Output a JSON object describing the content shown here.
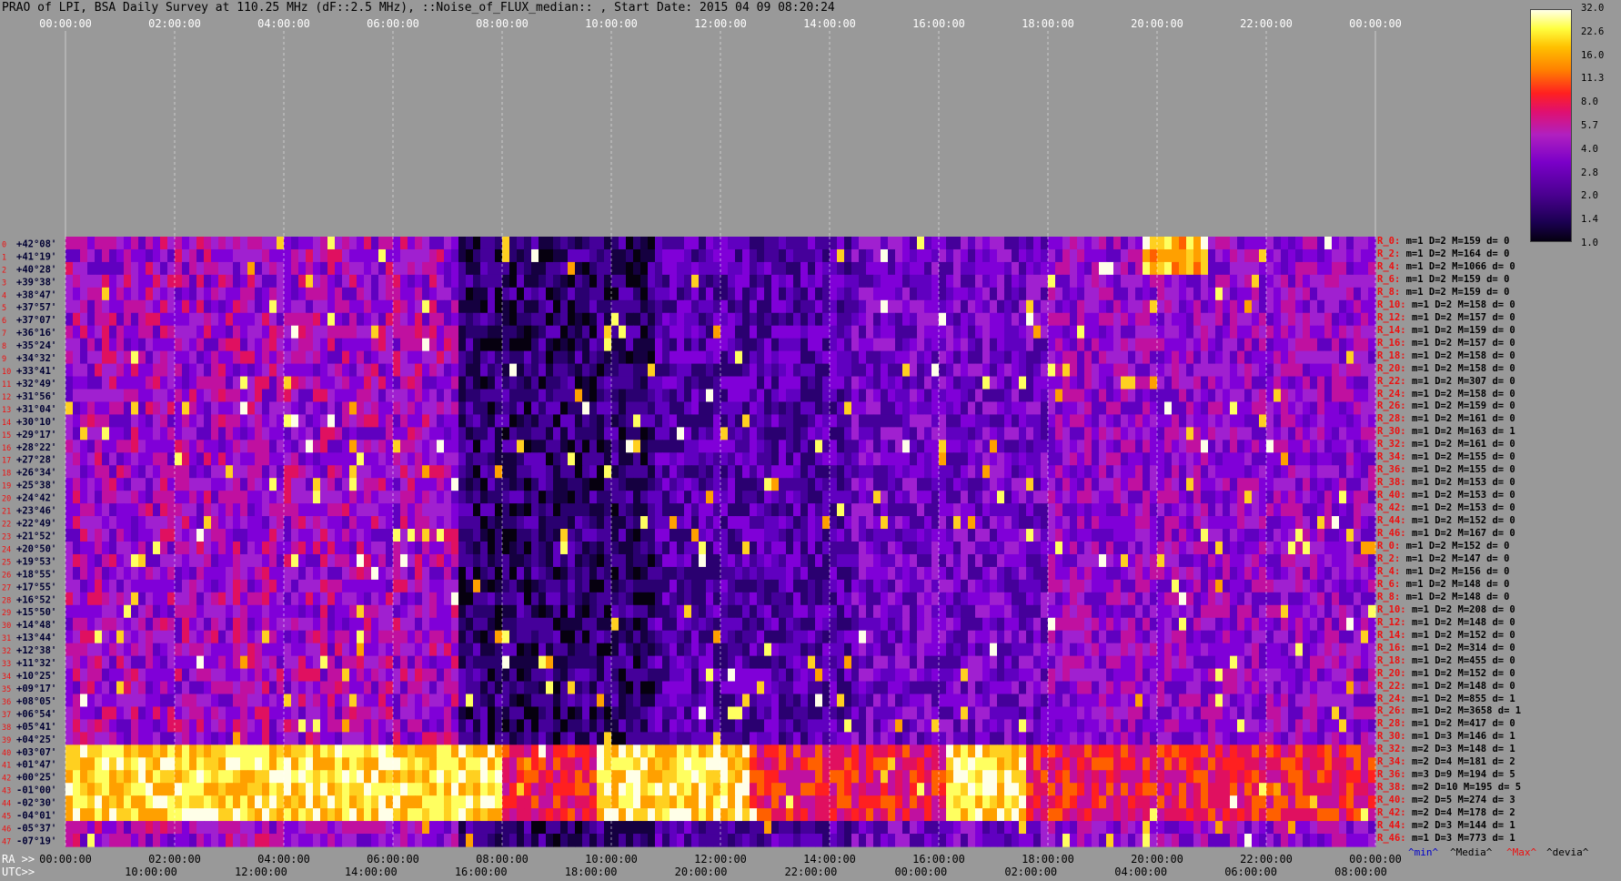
{
  "title": "PRAO of LPI, BSA Daily Survey at 110.25 MHz (dF::2.5 MHz), ::Noise_of_FLUX_median:: , Start Date: 2015 04 09 08:20:24",
  "chart_data": {
    "type": "heatmap",
    "top_axis_labels": [
      "00:00:00",
      "02:00:00",
      "04:00:00",
      "06:00:00",
      "08:00:00",
      "10:00:00",
      "12:00:00",
      "14:00:00",
      "16:00:00",
      "18:00:00",
      "20:00:00",
      "22:00:00",
      "00:00:00"
    ],
    "bottom_axis_prefix_ra": "RA >>",
    "bottom_axis_prefix_utc": "UTC>>",
    "ra_labels": [
      "00:00:00",
      "02:00:00",
      "04:00:00",
      "06:00:00",
      "08:00:00",
      "10:00:00",
      "12:00:00",
      "14:00:00",
      "16:00:00",
      "18:00:00",
      "20:00:00",
      "22:00:00",
      "00:00:00"
    ],
    "utc_labels": [
      "10:00:00",
      "12:00:00",
      "14:00:00",
      "16:00:00",
      "18:00:00",
      "20:00:00",
      "22:00:00",
      "00:00:00",
      "02:00:00",
      "04:00:00",
      "06:00:00",
      "08:00:00"
    ],
    "declinations": [
      "+42°08'",
      "+41°19'",
      "+40°28'",
      "+39°38'",
      "+38°47'",
      "+37°57'",
      "+37°07'",
      "+36°16'",
      "+35°24'",
      "+34°32'",
      "+33°41'",
      "+32°49'",
      "+31°56'",
      "+31°04'",
      "+30°10'",
      "+29°17'",
      "+28°22'",
      "+27°28'",
      "+26°34'",
      "+25°38'",
      "+24°42'",
      "+23°46'",
      "+22°49'",
      "+21°52'",
      "+20°50'",
      "+19°53'",
      "+18°55'",
      "+17°55'",
      "+16°52'",
      "+15°50'",
      "+14°48'",
      "+13°44'",
      "+12°38'",
      "+11°32'",
      "+10°25'",
      "+09°17'",
      "+08°05'",
      "+06°54'",
      "+05°41'",
      "+04°25'",
      "+03°07'",
      "+01°47'",
      "+00°25'",
      "-01°00'",
      "-02°30'",
      "-04°01'",
      "-05°37'",
      "-07°19'"
    ],
    "row_stats": [
      {
        "label": "R_0:",
        "stats": "m=1 D=2 M=159 d= 0"
      },
      {
        "label": "R_2:",
        "stats": "m=1 D=2 M=164 d= 0"
      },
      {
        "label": "R_4:",
        "stats": "m=1 D=2 M=1066 d= 0"
      },
      {
        "label": "R_6:",
        "stats": "m=1 D=2 M=159 d= 0"
      },
      {
        "label": "R_8:",
        "stats": "m=1 D=2 M=159 d= 0"
      },
      {
        "label": "R_10:",
        "stats": "m=1 D=2 M=158 d= 0"
      },
      {
        "label": "R_12:",
        "stats": "m=1 D=2 M=157 d= 0"
      },
      {
        "label": "R_14:",
        "stats": "m=1 D=2 M=159 d= 0"
      },
      {
        "label": "R_16:",
        "stats": "m=1 D=2 M=157 d= 0"
      },
      {
        "label": "R_18:",
        "stats": "m=1 D=2 M=158 d= 0"
      },
      {
        "label": "R_20:",
        "stats": "m=1 D=2 M=158 d= 0"
      },
      {
        "label": "R_22:",
        "stats": "m=1 D=2 M=307 d= 0"
      },
      {
        "label": "R_24:",
        "stats": "m=1 D=2 M=158 d= 0"
      },
      {
        "label": "R_26:",
        "stats": "m=1 D=2 M=159 d= 0"
      },
      {
        "label": "R_28:",
        "stats": "m=1 D=2 M=161 d= 0"
      },
      {
        "label": "R_30:",
        "stats": "m=1 D=2 M=163 d= 1"
      },
      {
        "label": "R_32:",
        "stats": "m=1 D=2 M=161 d= 0"
      },
      {
        "label": "R_34:",
        "stats": "m=1 D=2 M=155 d= 0"
      },
      {
        "label": "R_36:",
        "stats": "m=1 D=2 M=155 d= 0"
      },
      {
        "label": "R_38:",
        "stats": "m=1 D=2 M=153 d= 0"
      },
      {
        "label": "R_40:",
        "stats": "m=1 D=2 M=153 d= 0"
      },
      {
        "label": "R_42:",
        "stats": "m=1 D=2 M=153 d= 0"
      },
      {
        "label": "R_44:",
        "stats": "m=1 D=2 M=152 d= 0"
      },
      {
        "label": "R_46:",
        "stats": "m=1 D=2 M=167 d= 0"
      },
      {
        "label": "R_0:",
        "stats": "m=1 D=2 M=152 d= 0"
      },
      {
        "label": "R_2:",
        "stats": "m=1 D=2 M=147 d= 0"
      },
      {
        "label": "R_4:",
        "stats": "m=1 D=2 M=156 d= 0"
      },
      {
        "label": "R_6:",
        "stats": "m=1 D=2 M=148 d= 0"
      },
      {
        "label": "R_8:",
        "stats": "m=1 D=2 M=148 d= 0"
      },
      {
        "label": "R_10:",
        "stats": "m=1 D=2 M=208 d= 0"
      },
      {
        "label": "R_12:",
        "stats": "m=1 D=2 M=148 d= 0"
      },
      {
        "label": "R_14:",
        "stats": "m=1 D=2 M=152 d= 0"
      },
      {
        "label": "R_16:",
        "stats": "m=1 D=2 M=314 d= 0"
      },
      {
        "label": "R_18:",
        "stats": "m=1 D=2 M=455 d= 0"
      },
      {
        "label": "R_20:",
        "stats": "m=1 D=2 M=152 d= 0"
      },
      {
        "label": "R_22:",
        "stats": "m=1 D=2 M=148 d= 0"
      },
      {
        "label": "R_24:",
        "stats": "m=1 D=2 M=855 d= 1"
      },
      {
        "label": "R_26:",
        "stats": "m=1 D=2 M=3658 d= 1"
      },
      {
        "label": "R_28:",
        "stats": "m=1 D=2 M=417 d= 0"
      },
      {
        "label": "R_30:",
        "stats": "m=1 D=3 M=146 d= 1"
      },
      {
        "label": "R_32:",
        "stats": "m=2 D=3 M=148 d= 1"
      },
      {
        "label": "R_34:",
        "stats": "m=2 D=4 M=181 d= 2"
      },
      {
        "label": "R_36:",
        "stats": "m=3 D=9 M=194 d= 5"
      },
      {
        "label": "R_38:",
        "stats": "m=2 D=10 M=195 d= 5"
      },
      {
        "label": "R_40:",
        "stats": "m=2 D=5 M=274 d= 3"
      },
      {
        "label": "R_42:",
        "stats": "m=2 D=4 M=178 d= 2"
      },
      {
        "label": "R_44:",
        "stats": "m=2 D=3 M=144 d= 1"
      },
      {
        "label": "R_46:",
        "stats": "m=1 D=3 M=773 d= 1"
      }
    ],
    "legend_footer": {
      "min": "^min^",
      "median": "^Media^",
      "max": "^Max^",
      "dev": "^devia^"
    },
    "colorbar_ticks": [
      "32.0",
      "22.6",
      "16.0",
      "11.3",
      "8.0",
      "5.7",
      "4.0",
      "2.8",
      "2.0",
      "1.4",
      "1.0"
    ],
    "colors": {
      "background": "#999999",
      "low": "#050010",
      "mid": "#8000d0",
      "high": "#ff2020",
      "peak": "#ffffe8"
    }
  }
}
